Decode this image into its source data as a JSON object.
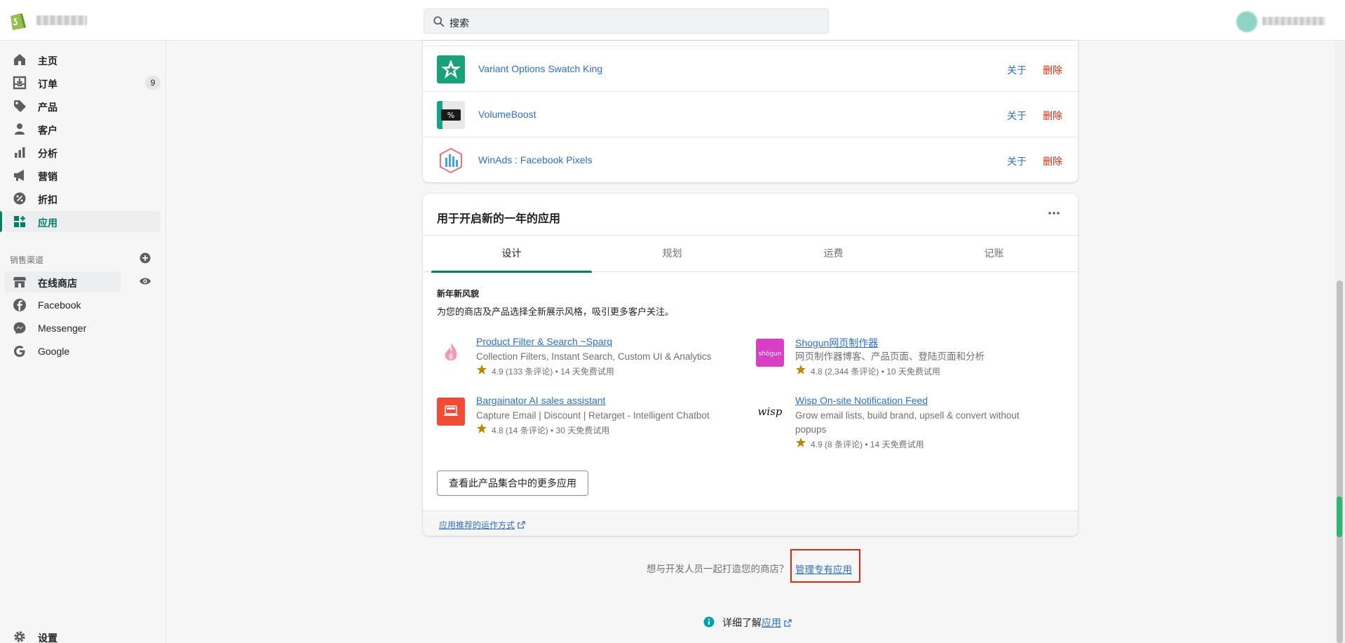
{
  "header": {
    "search_placeholder": "搜索"
  },
  "sidebar": {
    "items": [
      {
        "label": "主页",
        "icon": "home-icon"
      },
      {
        "label": "订单",
        "icon": "orders-icon",
        "badge": "9"
      },
      {
        "label": "产品",
        "icon": "tag-icon"
      },
      {
        "label": "客户",
        "icon": "customer-icon"
      },
      {
        "label": "分析",
        "icon": "analytics-icon"
      },
      {
        "label": "营销",
        "icon": "megaphone-icon"
      },
      {
        "label": "折扣",
        "icon": "discount-icon"
      },
      {
        "label": "应用",
        "icon": "apps-icon",
        "active": true
      }
    ],
    "sales_channels_title": "销售渠道",
    "channels": [
      {
        "label": "在线商店",
        "icon": "store-icon"
      },
      {
        "label": "Facebook",
        "icon": "facebook-icon"
      },
      {
        "label": "Messenger",
        "icon": "messenger-icon"
      },
      {
        "label": "Google",
        "icon": "google-icon"
      }
    ],
    "settings_label": "设置"
  },
  "installed_apps": {
    "about_label": "关于",
    "delete_label": "删除",
    "apps": [
      {
        "name": "Variant Options Swatch King"
      },
      {
        "name": "VolumeBoost"
      },
      {
        "name": "WinAds : Facebook Pixels"
      }
    ]
  },
  "recommend": {
    "title": "用于开启新的一年的应用",
    "tabs": [
      "设计",
      "规划",
      "运费",
      "记账"
    ],
    "active_tab": "设计",
    "promo_title": "新年新风貌",
    "promo_desc": "为您的商店及产品选择全新展示风格，吸引更多客户关注。",
    "apps": [
      {
        "name": "Product Filter & Search ~Sparq",
        "desc": "Collection Filters, Instant Search, Custom UI & Analytics",
        "meta": "4.9 (133 条评论) • 14 天免费试用"
      },
      {
        "name": "Shogun网页制作器",
        "desc": "网页制作器博客、产品页面、登陆页面和分析",
        "meta": "4.8 (2,344 条评论) • 10 天免费试用"
      },
      {
        "name": "Bargainator AI sales assistant",
        "desc": "Capture Email | Discount | Retarget - Intelligent Chatbot",
        "meta": "4.8 (14 条评论) • 30 天免费试用"
      },
      {
        "name": "Wisp On-site Notification Feed",
        "desc": "Grow email lists, build brand, upsell & convert without popups",
        "meta": "4.9 (8 条评论) • 14 天免费试用"
      }
    ],
    "more_button": "查看此产品集合中的更多应用",
    "footer_link": "应用推荐的运作方式"
  },
  "dev": {
    "text": "想与开发人员一起打造您的商店？",
    "link": "管理专有应用"
  },
  "learn": {
    "text": "详细了解",
    "link": "应用"
  },
  "colors": {
    "accent": "#008060",
    "link": "#2c6ecb",
    "critical": "#d72c0d"
  }
}
